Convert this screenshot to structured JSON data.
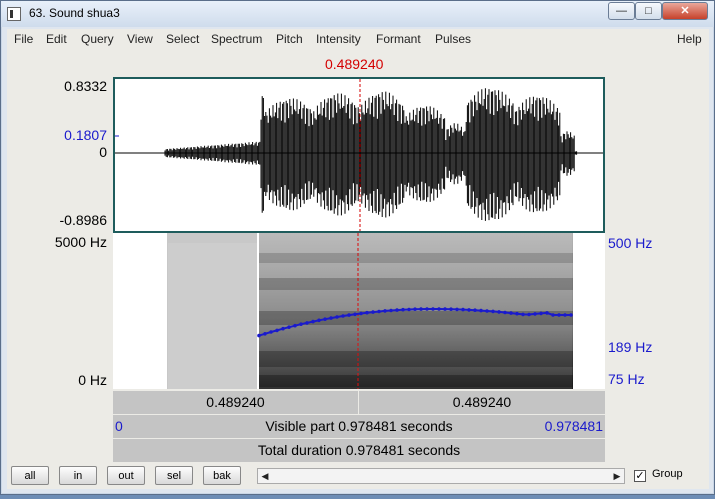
{
  "window": {
    "title": "63. Sound shua3",
    "minimize": "—",
    "maximize": "□",
    "close": "✕"
  },
  "menu": [
    "File",
    "Edit",
    "Query",
    "View",
    "Select",
    "Spectrum",
    "Pitch",
    "Intensity",
    "Formant",
    "Pulses",
    "Help"
  ],
  "cursor_time": "0.489240",
  "waveform": {
    "y_max": "0.8332",
    "y_cursor": "0.1807",
    "y_zero": "0",
    "y_min": "-0.8986"
  },
  "spectrogram": {
    "freq_max": "5000 Hz",
    "freq_min": "0 Hz",
    "pitch_top": "500 Hz",
    "pitch_mid": "189 Hz",
    "pitch_bottom": "75 Hz"
  },
  "time_bar": {
    "left_duration": "0.489240",
    "right_duration": "0.489240",
    "visible_start": "0",
    "visible_label": "Visible part 0.978481 seconds",
    "visible_end": "0.978481",
    "total_label": "Total duration 0.978481 seconds"
  },
  "buttons": {
    "all": "all",
    "in": "in",
    "out": "out",
    "sel": "sel",
    "bak": "bak"
  },
  "scroll": {
    "left_arrow": "◀",
    "right_arrow": "▶"
  },
  "group": {
    "checked": true,
    "check_mark": "✓",
    "label": "Group"
  },
  "colors": {
    "cursor": "#d40000",
    "pitch": "#1a1acc",
    "axis_blue": "#1a1acc"
  }
}
